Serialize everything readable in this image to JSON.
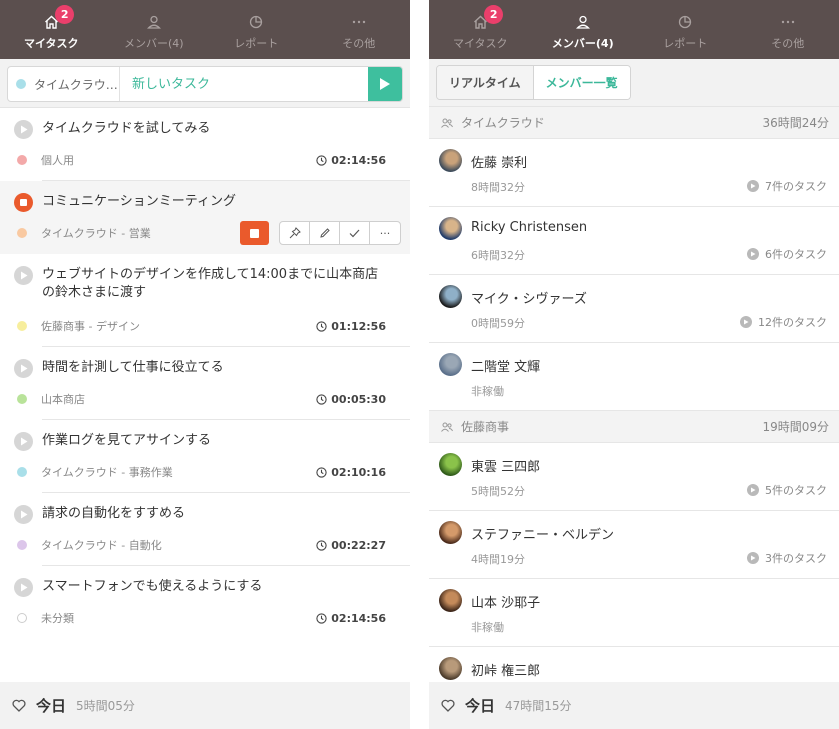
{
  "left": {
    "nav": [
      {
        "label": "マイタスク",
        "badge": "2",
        "icon": "home-icon",
        "active": true
      },
      {
        "label": "メンバー(4)",
        "icon": "person-icon"
      },
      {
        "label": "レポート",
        "icon": "report-icon"
      },
      {
        "label": "その他",
        "icon": "more-icon"
      }
    ],
    "new_task": {
      "project": "タイムクラウ…",
      "placeholder": "新しいタスク",
      "project_color": "#a9dfe9"
    },
    "tasks": [
      {
        "title": "タイムクラウドを試してみる",
        "project": "個人用",
        "color": "#f3a9a9",
        "duration": "02:14:56"
      },
      {
        "title": "コミュニケーションミーティング",
        "project": "タイムクラウド - 営業",
        "color": "#f9c9a1",
        "running": true
      },
      {
        "title": "ウェブサイトのデザインを作成して14:00までに山本商店の鈴木さまに渡す",
        "project": "佐藤商事 - デザイン",
        "color": "#f7ee9d",
        "duration": "01:12:56"
      },
      {
        "title": "時間を計測して仕事に役立てる",
        "project": "山本商店",
        "color": "#b9e39a",
        "duration": "00:05:30"
      },
      {
        "title": "作業ログを見てアサインする",
        "project": "タイムクラウド - 事務作業",
        "color": "#a9dfe9",
        "duration": "02:10:16"
      },
      {
        "title": "請求の自動化をすすめる",
        "project": "タイムクラウド - 自動化",
        "color": "#dcc6ea",
        "duration": "00:22:27"
      },
      {
        "title": "スマートフォンでも使えるようにする",
        "project": "未分類",
        "color": "hollow",
        "duration": "02:14:56"
      }
    ],
    "actions": {
      "more": "···"
    },
    "footer": {
      "today": "今日",
      "total": "5時間05分"
    }
  },
  "right": {
    "nav": [
      {
        "label": "マイタスク",
        "badge": "2",
        "icon": "home-icon"
      },
      {
        "label": "メンバー(4)",
        "icon": "person-icon",
        "active": true
      },
      {
        "label": "レポート",
        "icon": "report-icon"
      },
      {
        "label": "その他",
        "icon": "more-icon"
      }
    ],
    "segments": [
      "リアルタイム",
      "メンバー一覧"
    ],
    "groups": [
      {
        "name": "タイムクラウド",
        "total": "36時間24分",
        "members": [
          {
            "name": "佐藤 崇利",
            "time": "8時間32分",
            "tasks": "7件のタスク",
            "avatar": [
              "#3b4a5a",
              "#c9a27a"
            ]
          },
          {
            "name": "Ricky Christensen",
            "time": "6時間32分",
            "tasks": "6件のタスク",
            "avatar": [
              "#1e3a6a",
              "#d8b48a"
            ]
          },
          {
            "name": "マイク・シヴァーズ",
            "time": "0時間59分",
            "tasks": "12件のタスク",
            "avatar": [
              "#1a1a1a",
              "#8fb0c8"
            ]
          },
          {
            "name": "二階堂 文輝",
            "time": "非稼働",
            "avatar": [
              "#5a6f8a",
              "#9aa7b5"
            ]
          }
        ]
      },
      {
        "name": "佐藤商事",
        "total": "19時間09分",
        "members": [
          {
            "name": "東雲 三四郎",
            "time": "5時間52分",
            "tasks": "5件のタスク",
            "avatar": [
              "#2f5a1a",
              "#8ac24a"
            ]
          },
          {
            "name": "ステファニー・ベルデン",
            "time": "4時間19分",
            "tasks": "3件のタスク",
            "avatar": [
              "#4a2a1a",
              "#d49a6a"
            ]
          },
          {
            "name": "山本 沙耶子",
            "time": "非稼働",
            "avatar": [
              "#3a2418",
              "#c48a5a"
            ]
          },
          {
            "name": "初峠 権三郎",
            "time": "",
            "avatar": [
              "#4a3a2a",
              "#b89a7a"
            ]
          }
        ]
      }
    ],
    "footer": {
      "today": "今日",
      "total": "47時間15分"
    }
  }
}
